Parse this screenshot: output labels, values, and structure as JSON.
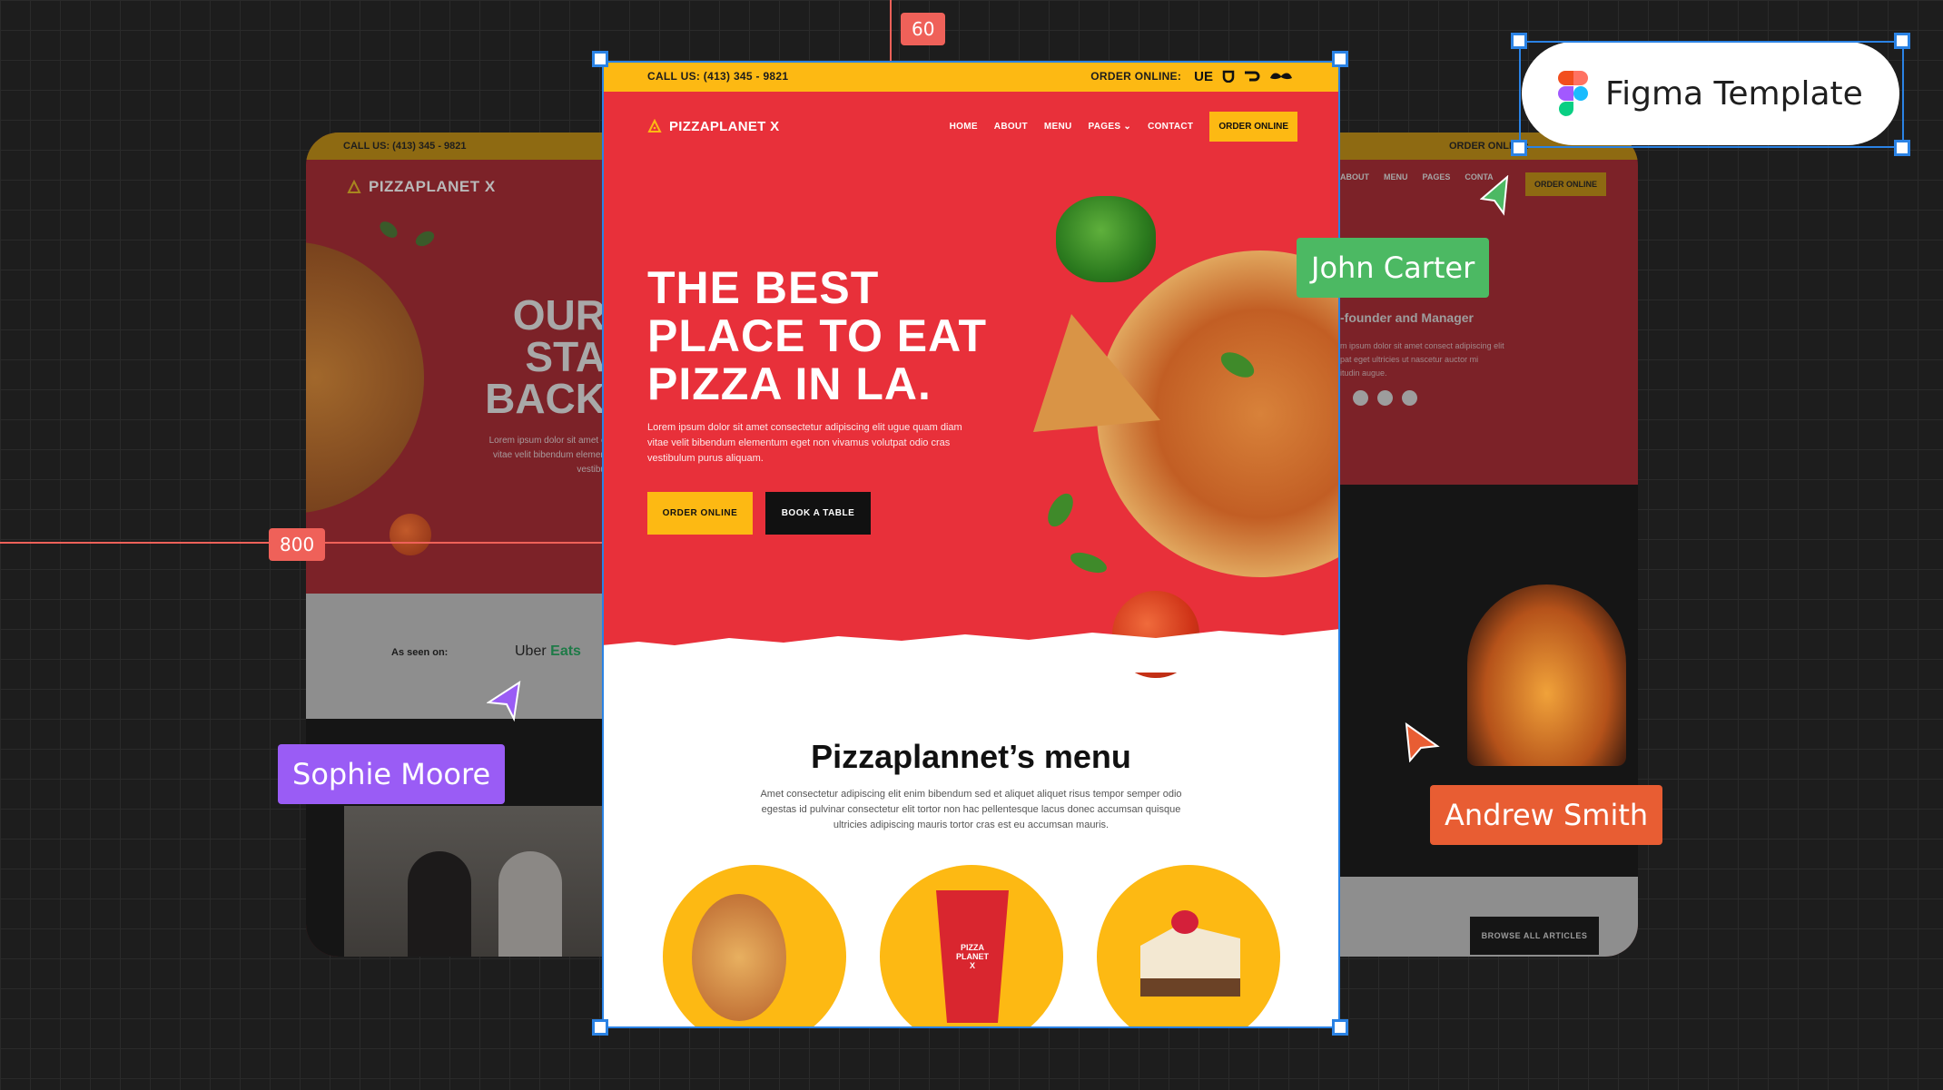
{
  "canvas": {
    "ruler_vertical_label": "60",
    "ruler_horizontal_label": "800",
    "badge": {
      "label": "Figma Template"
    },
    "cursors": [
      {
        "name": "John Carter",
        "color": "#4cb963"
      },
      {
        "name": "Sophie Moore",
        "color": "#9a5cf5"
      },
      {
        "name": "Andrew Smith",
        "color": "#e85d33"
      }
    ],
    "colors": {
      "selection": "#2a82e4",
      "ruler": "#ef6159"
    }
  },
  "site": {
    "colors": {
      "red": "#e8303a",
      "yellow": "#fdb913",
      "black": "#111111"
    },
    "topbar": {
      "call": "CALL US: (413) 345 - 9821",
      "order_label": "ORDER ONLINE:",
      "delivery_icons": [
        "ubereats-icon",
        "grubhub-icon",
        "doordash-icon",
        "postmates-icon"
      ]
    },
    "nav": {
      "logo": "PIZZAPLANET X",
      "links": [
        "HOME",
        "ABOUT",
        "MENU",
        "PAGES",
        "CONTACT"
      ],
      "cta": "ORDER ONLINE"
    },
    "hero": {
      "headline": [
        "THE BEST",
        "PLACE TO EAT",
        "PIZZA IN LA."
      ],
      "paragraph": "Lorem ipsum dolor sit amet consectetur adipiscing elit ugue quam diam vitae velit bibendum elementum eget non vivamus volutpat odio cras vestibulum purus aliquam.",
      "btn_order": "ORDER ONLINE",
      "btn_book": "BOOK A TABLE"
    },
    "menu": {
      "title": "Pizzaplannet’s menu",
      "paragraph": "Amet consectetur adipiscing elit enim bibendum sed et aliquet aliquet risus tempor semper odio egestas id pulvinar consectetur elit tortor non hac pellentesque lacus donec accumsan quisque ultricies adipiscing mauris tortor cras est eu accumsan mauris.",
      "items": [
        "pizza",
        "drink",
        "cheesecake"
      ],
      "cup_text": "PIZZA PLANET X"
    }
  },
  "left_card": {
    "call": "CALL US: (413) 345 - 9821",
    "logo": "PIZZAPLANET X",
    "headline": [
      "OUR",
      "STA",
      "BACK"
    ],
    "paragraph": [
      "Lorem ipsum dolor sit amet c",
      "vitae velit bibendum elemen",
      "vestibu"
    ],
    "seen_on": "As seen on:",
    "uber": "Uber",
    "eats": "Eats"
  },
  "right_card": {
    "order_label": "ORDER ONLINE:",
    "links": [
      "ABOUT",
      "MENU",
      "PAGES",
      "CONTA"
    ],
    "cta": "ORDER ONLINE",
    "role": "-founder and Manager",
    "paragraph": [
      "m ipsum dolor sit amet consect adipiscing elit",
      "pat eget ultricies ut nascetur auctor mi",
      "itudin augue."
    ],
    "browse": "BROWSE ALL ARTICLES"
  }
}
